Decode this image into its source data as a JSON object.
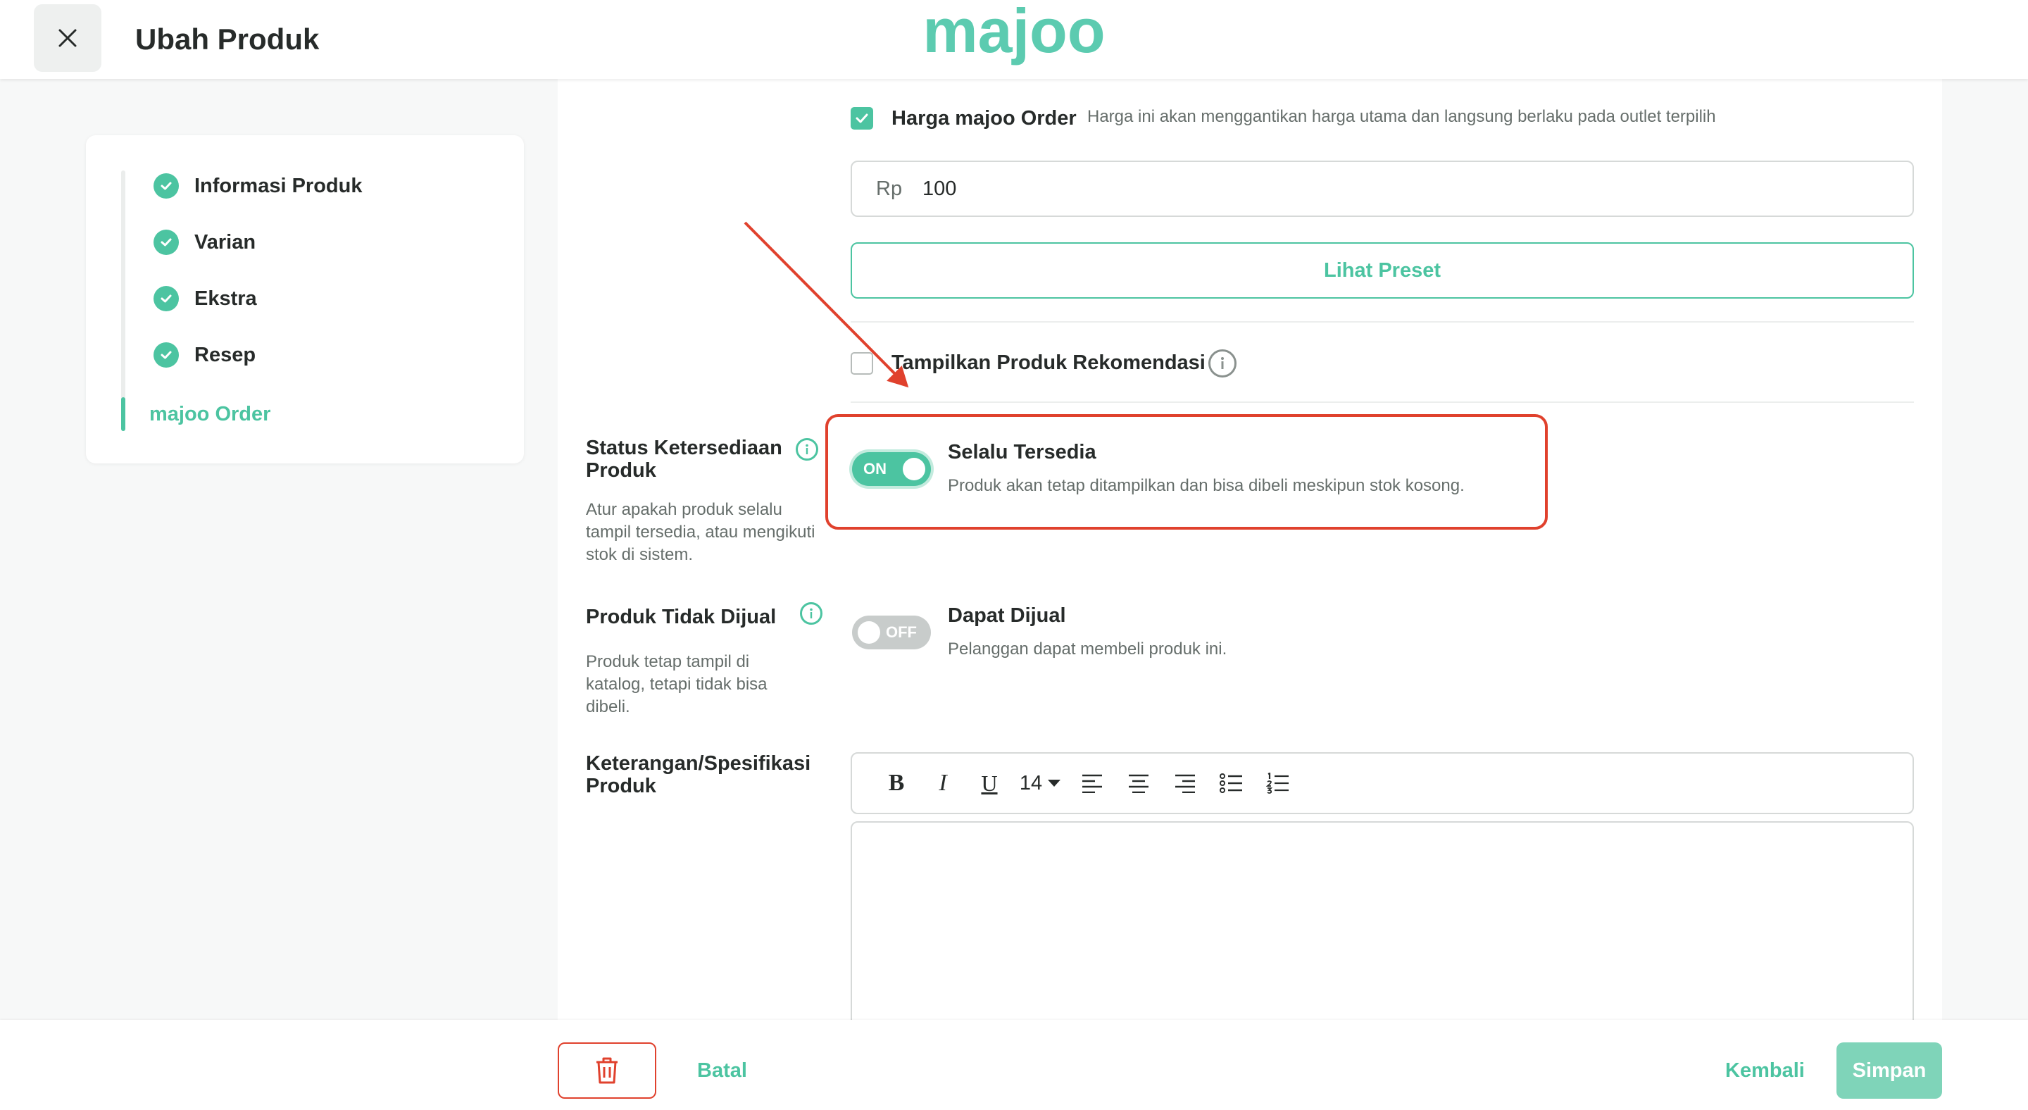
{
  "header": {
    "title": "Ubah Produk",
    "brand": "majoo"
  },
  "stepper": {
    "items": [
      {
        "label": "Informasi Produk"
      },
      {
        "label": "Varian"
      },
      {
        "label": "Ekstra"
      },
      {
        "label": "Resep"
      },
      {
        "label": "majoo Order"
      }
    ]
  },
  "price": {
    "checkbox_label": "Harga majoo Order",
    "hint": "Harga ini akan menggantikan harga utama dan langsung berlaku pada outlet terpilih",
    "currency_prefix": "Rp",
    "value": "100",
    "preset_button": "Lihat Preset"
  },
  "recommendation": {
    "label": "Tampilkan Produk Rekomendasi"
  },
  "availability": {
    "title": "Status Ketersediaan Produk",
    "description": "Atur apakah produk selalu tampil tersedia, atau mengikuti stok di sistem.",
    "toggle_text": "ON",
    "option_title": "Selalu Tersedia",
    "option_desc": "Produk akan tetap ditampilkan dan bisa dibeli meskipun stok kosong."
  },
  "not_for_sale": {
    "title": "Produk Tidak Dijual",
    "description": "Produk tetap tampil di katalog, tetapi tidak bisa dibeli.",
    "toggle_text": "OFF",
    "option_title": "Dapat Dijual",
    "option_desc": "Pelanggan dapat membeli produk ini."
  },
  "specification": {
    "title": "Keterangan/Spesifikasi Produk",
    "font_size": "14"
  },
  "footer": {
    "cancel_label": "Batal",
    "back_label": "Kembali",
    "save_label": "Simpan"
  },
  "colors": {
    "accent": "#4cc4a1",
    "danger": "#e0412d"
  }
}
